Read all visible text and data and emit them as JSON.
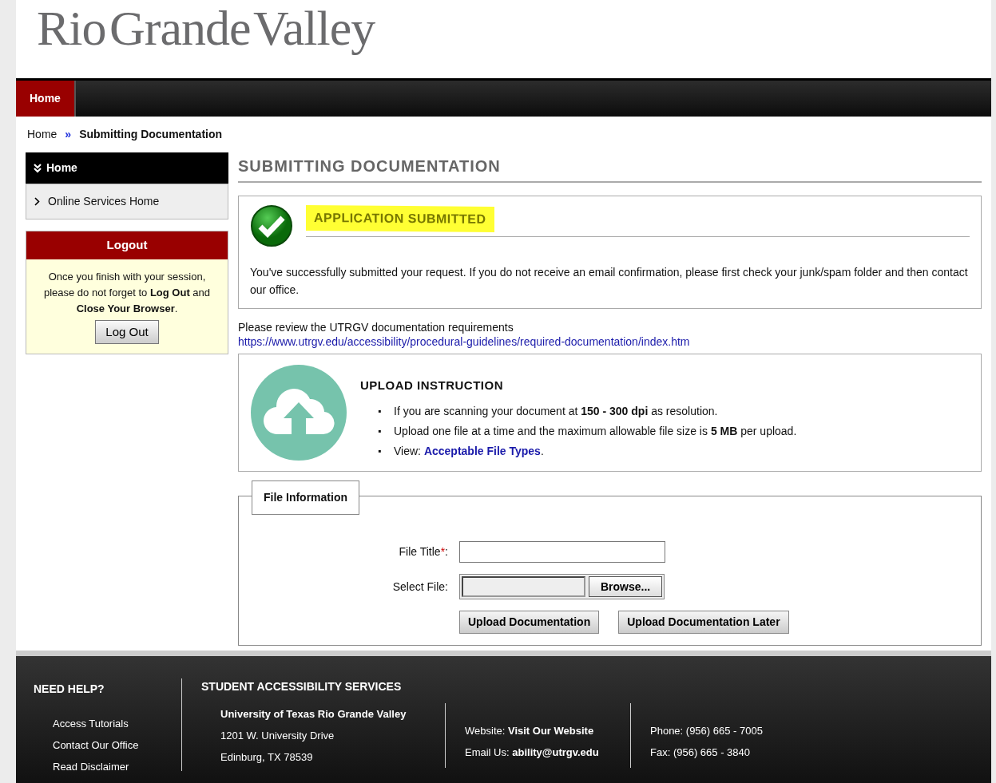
{
  "logo": "Rio Grande Valley",
  "nav": [
    {
      "label": "Home",
      "selected": true
    }
  ],
  "breadcrumb": {
    "separator": "»",
    "items": [
      {
        "label": "Home",
        "current": false
      },
      {
        "label": "Submitting Documentation",
        "current": true
      }
    ]
  },
  "sidebar": {
    "heading": "Home",
    "items": [
      {
        "label": "Online Services Home"
      }
    ]
  },
  "logout_panel": {
    "title": "Logout",
    "message": "Once you finish with your session, please do not forget to **Log Out** and **Close Your Browser**.",
    "button": "Log Out"
  },
  "page_title": "SUBMITTING DOCUMENTATION",
  "success": {
    "title": "APPLICATION SUBMITTED",
    "message": "You've successfully submitted your request. If you do not receive an email confirmation, please first check your junk/spam folder and then contact our office."
  },
  "review": {
    "text": "Please review the UTRGV documentation requirements",
    "link": "https://www.utrgv.edu/accessibility/procedural-guidelines/required-documentation/index.htm"
  },
  "upload_instruction": {
    "title": "UPLOAD INSTRUCTION",
    "bullets": [
      {
        "marker": "▪",
        "text": "If you are scanning your document at **150 - 300 dpi** as resolution."
      },
      {
        "marker": "▪",
        "text": "Upload one file at a time and the maximum allowable file size is **5 MB** per upload."
      },
      {
        "marker": "▪",
        "text": "View:",
        "link": "Acceptable File Types",
        "after": "."
      }
    ]
  },
  "file_form": {
    "legend": "File Information",
    "fields": [
      {
        "kind": "text",
        "label": "File Title",
        "required": true,
        "required_mark": "*",
        "suffix": ":"
      },
      {
        "kind": "file",
        "label": "Select File:",
        "button": "Browse..."
      }
    ],
    "buttons": [
      "Upload Documentation",
      "Upload Documentation Later"
    ]
  },
  "footer": {
    "help_heading": "NEED HELP?",
    "help_links": [
      "Access Tutorials",
      "Contact Our Office",
      "Read Disclaimer"
    ],
    "sas_heading": "STUDENT ACCESSIBILITY SERVICES",
    "address": [
      "University of Texas Rio Grande Valley",
      "1201 W. University Drive",
      "Edinburg, TX 78539"
    ],
    "web": [
      {
        "label": "Website:",
        "value": "Visit Our Website"
      },
      {
        "label": "Email Us:",
        "value": "ability@utrgv.edu"
      }
    ],
    "phones": [
      "Phone: (956) 665 - 7005",
      "Fax: (956) 665 - 3840"
    ]
  }
}
